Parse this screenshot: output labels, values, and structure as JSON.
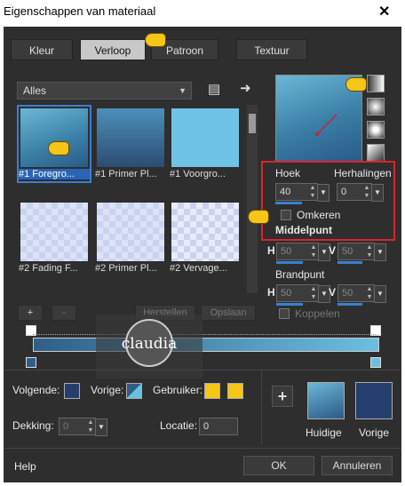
{
  "window": {
    "title": "Eigenschappen van materiaal",
    "close": "✕"
  },
  "tabs": [
    {
      "label": "Kleur"
    },
    {
      "label": "Verloop"
    },
    {
      "label": "Patroon"
    },
    {
      "label": "Textuur"
    }
  ],
  "gallery": {
    "category": "Alles",
    "items": [
      {
        "label": "#1 Foregro..."
      },
      {
        "label": "#1 Primer Pl..."
      },
      {
        "label": "#1 Voorgro..."
      },
      {
        "label": "#2 Fading F..."
      },
      {
        "label": "#2 Primer Pl..."
      },
      {
        "label": "#2 Vervage..."
      }
    ]
  },
  "angle": {
    "label": "Hoek",
    "value": "40"
  },
  "repeats": {
    "label": "Herhalingen",
    "value": "0"
  },
  "invert": {
    "label": "Omkeren"
  },
  "center": {
    "label": "Middelpunt",
    "h_label": "H",
    "h_value": "50",
    "v_label": "V",
    "v_value": "50"
  },
  "focal": {
    "label": "Brandpunt",
    "h_label": "H",
    "h_value": "50",
    "v_label": "V",
    "v_value": "50",
    "link_label": "Koppelen"
  },
  "edit_buttons": {
    "add": "+",
    "remove": "-",
    "save": "Herstellen",
    "delete": "Opslaan"
  },
  "stops": {
    "next_label": "Volgende:",
    "prev_label": "Vorige:",
    "user_label": "Gebruiker:",
    "opacity_label": "Dekking:",
    "opacity_value": "0",
    "location_label": "Locatie:",
    "location_value": "0"
  },
  "swatches": {
    "current_label": "Huidige",
    "previous_label": "Vorige",
    "add": "+"
  },
  "footer": {
    "help": "Help",
    "ok": "OK",
    "cancel": "Annuleren"
  },
  "colors": {
    "accent": "#3a7fd1",
    "highlight": "#e0212d",
    "pointer": "#f5c518",
    "gradient_dark": "#2f5e87",
    "gradient_light": "#6bbfe0",
    "previous": "#243f6d"
  },
  "watermark": "claudia"
}
